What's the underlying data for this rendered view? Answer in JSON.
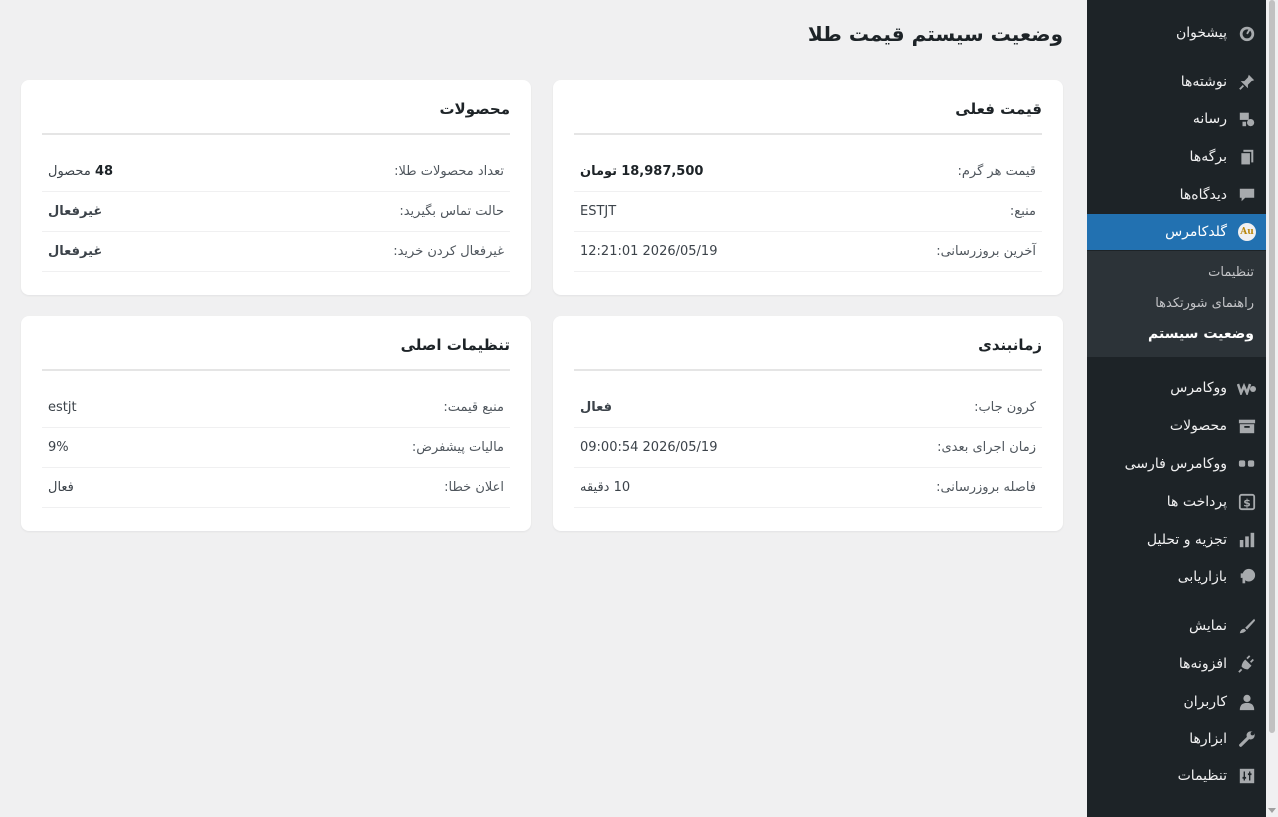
{
  "page": {
    "title": "وضعیت سیستم قیمت طلا"
  },
  "sidebar": {
    "items": [
      {
        "label": "پیشخوان",
        "icon": "dashboard-icon"
      },
      {
        "label": "نوشته‌ها",
        "icon": "pin-icon"
      },
      {
        "label": "رسانه",
        "icon": "media-icon"
      },
      {
        "label": "برگه‌ها",
        "icon": "pages-icon"
      },
      {
        "label": "دیدگاه‌ها",
        "icon": "comments-icon"
      },
      {
        "label": "گلدکامرس",
        "icon": "au-icon",
        "badge": "Au"
      },
      {
        "label": "ووکامرس",
        "icon": "woo-icon"
      },
      {
        "label": "محصولات",
        "icon": "archive-icon"
      },
      {
        "label": "ووکامرس فارسی",
        "icon": "quote-icon"
      },
      {
        "label": "پرداخت ها",
        "icon": "payment-icon"
      },
      {
        "label": "تجزیه و تحلیل",
        "icon": "chart-icon"
      },
      {
        "label": "بازاریابی",
        "icon": "megaphone-icon"
      },
      {
        "label": "نمایش",
        "icon": "brush-icon"
      },
      {
        "label": "افزونه‌ها",
        "icon": "plugin-icon"
      },
      {
        "label": "کاربران",
        "icon": "user-icon"
      },
      {
        "label": "ابزارها",
        "icon": "wrench-icon"
      },
      {
        "label": "تنظیمات",
        "icon": "settings-icon"
      }
    ],
    "submenu": [
      {
        "label": "تنظیمات"
      },
      {
        "label": "راهنمای شورتکدها"
      },
      {
        "label": "وضعیت سیستم"
      }
    ]
  },
  "cards": {
    "price": {
      "title": "قیمت فعلی",
      "rows": [
        {
          "label": "قیمت هر گرم:",
          "value": "18,987,500",
          "unit": "تومان"
        },
        {
          "label": "منبع:",
          "value": "ESTJT"
        },
        {
          "label": "آخرین بروزرسانی:",
          "value": "2026/05/19 12:21:01"
        }
      ]
    },
    "products": {
      "title": "محصولات",
      "rows": [
        {
          "label": "تعداد محصولات طلا:",
          "value": "48",
          "unit": "محصول"
        },
        {
          "label": "حالت تماس بگیرید:",
          "value": "غیرفعال"
        },
        {
          "label": "غیرفعال کردن خرید:",
          "value": "غیرفعال"
        }
      ]
    },
    "schedule": {
      "title": "زمانبندی",
      "rows": [
        {
          "label": "کرون جاب:",
          "value": "فعال"
        },
        {
          "label": "زمان اجرای بعدی:",
          "value": "2026/05/19 09:00:54"
        },
        {
          "label": "فاصله بروزرسانی:",
          "value": "10 دقیقه"
        }
      ]
    },
    "settings": {
      "title": "تنظیمات اصلی",
      "rows": [
        {
          "label": "منبع قیمت:",
          "value": "estjt"
        },
        {
          "label": "مالیات پیشفرض:",
          "value": "9%"
        },
        {
          "label": "اعلان خطا:",
          "value": "فعال"
        }
      ]
    }
  },
  "colors": {
    "sidebar_bg": "#1d2327",
    "active_bg": "#2271b1",
    "status_green": "#2e7d32"
  }
}
